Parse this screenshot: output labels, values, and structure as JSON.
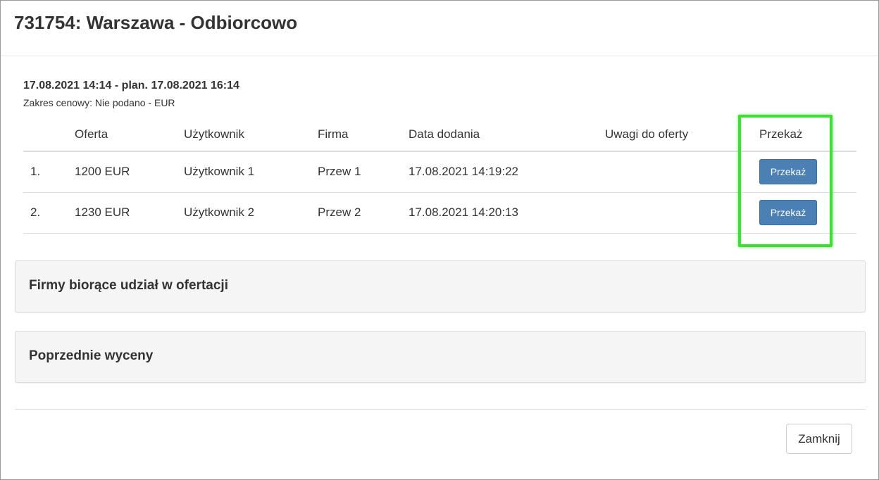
{
  "modal": {
    "title": "731754: Warszawa - Odbiorcowo"
  },
  "schedule": {
    "date_line": "17.08.2021 14:14 - plan. 17.08.2021 16:14",
    "price_range": "Zakres cenowy: Nie podano - EUR"
  },
  "offers_table": {
    "headers": {
      "number": "",
      "offer": "Oferta",
      "user": "Użytkownik",
      "firm": "Firma",
      "date_added": "Data dodania",
      "notes": "Uwagi do oferty",
      "transfer": "Przekaż"
    },
    "rows": [
      {
        "number": "1.",
        "offer": "1200 EUR",
        "user": "Użytkownik 1",
        "firm": "Przew 1",
        "date_added": "17.08.2021 14:19:22",
        "notes": "",
        "transfer_label": "Przekaż"
      },
      {
        "number": "2.",
        "offer": "1230 EUR",
        "user": "Użytkownik 2",
        "firm": "Przew 2",
        "date_added": "17.08.2021 14:20:13",
        "notes": "",
        "transfer_label": "Przekaż"
      }
    ]
  },
  "panels": {
    "participating_firms": "Firmy biorące udział w ofertacji",
    "previous_quotes": "Poprzednie wyceny"
  },
  "footer": {
    "close_label": "Zamknij"
  },
  "colors": {
    "primary_button": "#4a80b4",
    "highlight": "#38e22e",
    "panel_bg": "#f5f5f5"
  }
}
